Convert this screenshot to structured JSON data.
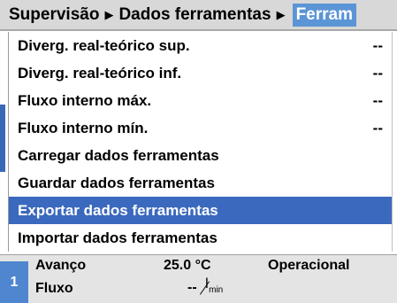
{
  "breadcrumb": {
    "items": [
      "Supervisão",
      "Dados ferramentas"
    ],
    "separator": "▶",
    "active": "Ferram"
  },
  "menu": {
    "items": [
      {
        "label": "Diverg. real-teórico sup.",
        "value": "--"
      },
      {
        "label": "Diverg. real-teórico inf.",
        "value": "--"
      },
      {
        "label": "Fluxo interno máx.",
        "value": "--"
      },
      {
        "label": "Fluxo interno mín.",
        "value": "--"
      },
      {
        "label": "Carregar dados ferramentas",
        "value": ""
      },
      {
        "label": "Guardar dados ferramentas",
        "value": ""
      },
      {
        "label": "Exportar dados ferramentas",
        "value": "",
        "selected": true
      },
      {
        "label": "Importar dados ferramentas",
        "value": ""
      }
    ]
  },
  "status": {
    "index": "1",
    "advance_label": "Avanço",
    "advance_value": "25.0 °C",
    "flow_label": "Fluxo",
    "flow_value": "--",
    "flow_unit_top": "l",
    "flow_unit_bottom": "min",
    "state": "Operacional"
  },
  "colors": {
    "selection": "#3b69bd",
    "active_crumb": "#5b95d5",
    "header_bg": "#d8d8d8",
    "status_bg": "#e4e4e4"
  }
}
